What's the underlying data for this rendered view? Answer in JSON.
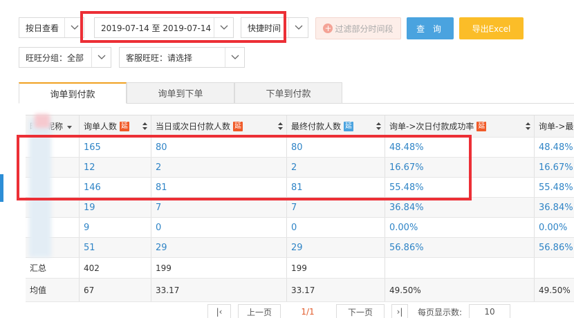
{
  "filters": {
    "period_mode": "按日查看",
    "date_range": "2019-07-14 至 2019-07-14",
    "quick_time": "快捷时间",
    "filter_button": "过滤部分时间段",
    "query_button": "查 询",
    "export_button": "导出Excel",
    "group": "旺旺分组：全部",
    "service_label": "客服旺旺：",
    "service_placeholder": "请选择"
  },
  "tabs": [
    "询单到付款",
    "询单到下单",
    "下单到付款"
  ],
  "table": {
    "headers": [
      {
        "label": "旺旺昵称",
        "tag": ""
      },
      {
        "label": "询单人数",
        "tag": "延"
      },
      {
        "label": "当日或次日付款人数",
        "tag": "延"
      },
      {
        "label": "最终付款人数",
        "tag": "延"
      },
      {
        "label": "询单->次日付款成功率",
        "tag": "延"
      },
      {
        "label": "询单->最",
        "tag": ""
      }
    ],
    "rows": [
      {
        "nickname": "",
        "inquiries": "165",
        "paid_next_day": "80",
        "final_paid": "80",
        "rate_next_day": "48.48%",
        "rate_final": "48.48%"
      },
      {
        "nickname": "",
        "inquiries": "12",
        "paid_next_day": "2",
        "final_paid": "2",
        "rate_next_day": "16.67%",
        "rate_final": "16.67%"
      },
      {
        "nickname": "",
        "inquiries": "146",
        "paid_next_day": "81",
        "final_paid": "81",
        "rate_next_day": "55.48%",
        "rate_final": "55.48%"
      },
      {
        "nickname": "",
        "inquiries": "19",
        "paid_next_day": "7",
        "final_paid": "7",
        "rate_next_day": "36.84%",
        "rate_final": "36.84%"
      },
      {
        "nickname": "",
        "inquiries": "9",
        "paid_next_day": "0",
        "final_paid": "0",
        "rate_next_day": "0.00%",
        "rate_final": "0.00%"
      },
      {
        "nickname": "",
        "inquiries": "51",
        "paid_next_day": "29",
        "final_paid": "29",
        "rate_next_day": "56.86%",
        "rate_final": "56.86%"
      }
    ],
    "total": {
      "label": "汇总",
      "inquiries": "402",
      "paid_next_day": "199",
      "final_paid": "199",
      "rate_next_day": "",
      "rate_final": ""
    },
    "average": {
      "label": "均值",
      "inquiries": "67",
      "paid_next_day": "33.17",
      "final_paid": "33.17",
      "rate_next_day": "49.50%",
      "rate_final": "49.50%"
    }
  },
  "pagination": {
    "prev": "上一页",
    "page_info": "1/1",
    "next": "下一页",
    "per_page_label": "每页显示数:",
    "per_page_value": "10"
  },
  "colors": {
    "accent_blue": "#4aa3df",
    "export_yellow": "#fbbd28",
    "tag_orange": "#f05a28",
    "tag_blue": "#4aa3df",
    "highlight_red": "#ec2f36",
    "link_blue": "#2f84c6"
  }
}
